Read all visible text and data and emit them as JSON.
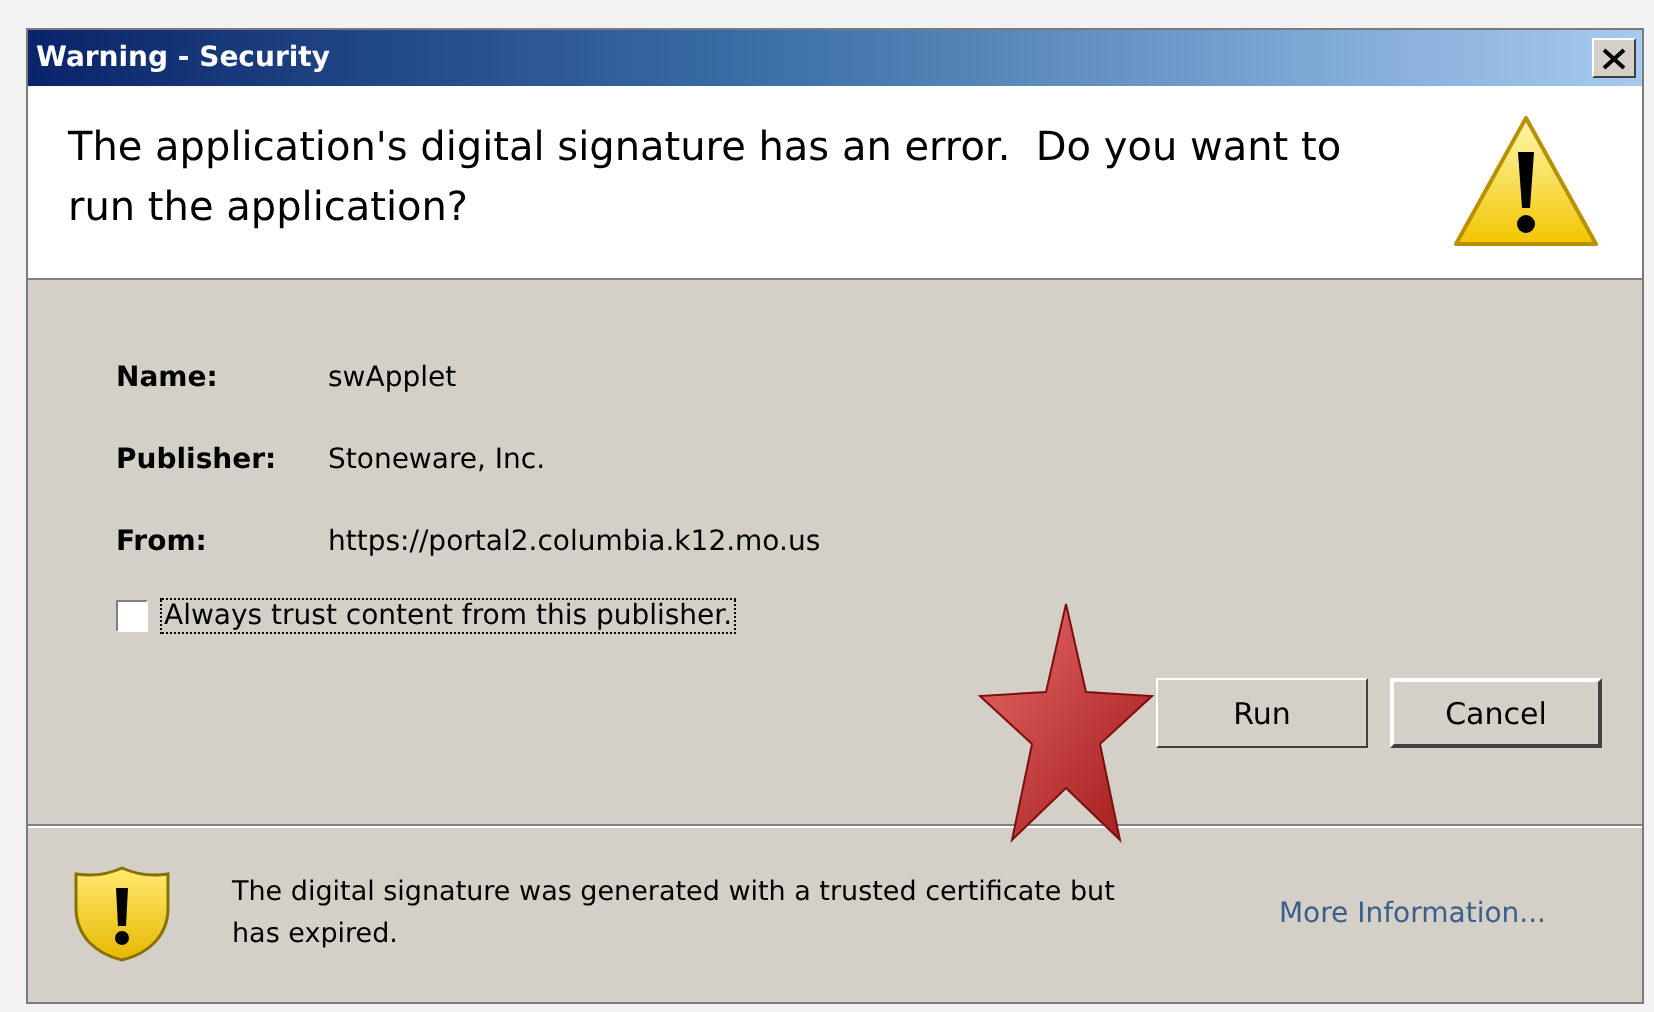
{
  "window": {
    "title": "Warning - Security"
  },
  "header": {
    "message": "The application's digital signature has an error.  Do you want to run the application?"
  },
  "details": [
    {
      "label": "Name:",
      "value": "swApplet"
    },
    {
      "label": "Publisher:",
      "value": "Stoneware, Inc."
    },
    {
      "label": "From:",
      "value": "https://portal2.columbia.k12.mo.us"
    }
  ],
  "trust_checkbox": {
    "label": "Always trust content from this publisher.",
    "checked": false
  },
  "buttons": [
    {
      "label": "Run",
      "default": false
    },
    {
      "label": "Cancel",
      "default": true
    }
  ],
  "footer": {
    "message": "The digital signature was generated with a trusted certificate but has expired.",
    "link": "More Information..."
  }
}
